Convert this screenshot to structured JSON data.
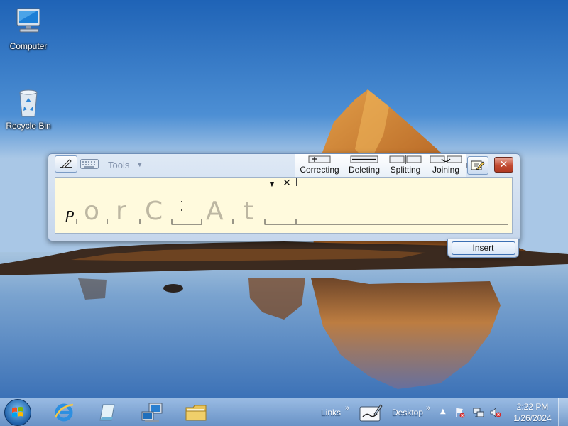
{
  "desktop": {
    "icons": [
      {
        "label": "Computer"
      },
      {
        "label": "Recycle Bin"
      }
    ]
  },
  "tip": {
    "toolbar": {
      "tools_label": "Tools"
    },
    "gestures": [
      {
        "label": "Correcting"
      },
      {
        "label": "Deleting"
      },
      {
        "label": "Splitting"
      },
      {
        "label": "Joining"
      }
    ],
    "pad": {
      "ink_char": "P",
      "recognized_chars": [
        "o",
        "r",
        "C",
        "A",
        "t"
      ]
    },
    "insert_label": "Insert"
  },
  "taskbar": {
    "links_label": "Links",
    "desktop_label": "Desktop",
    "clock": {
      "time": "2:22 PM",
      "date": "1/26/2024"
    }
  },
  "colors": {
    "pad_background": "#fffadd",
    "close_red": "#c24b32",
    "accent_blue": "#3b6fb3"
  }
}
